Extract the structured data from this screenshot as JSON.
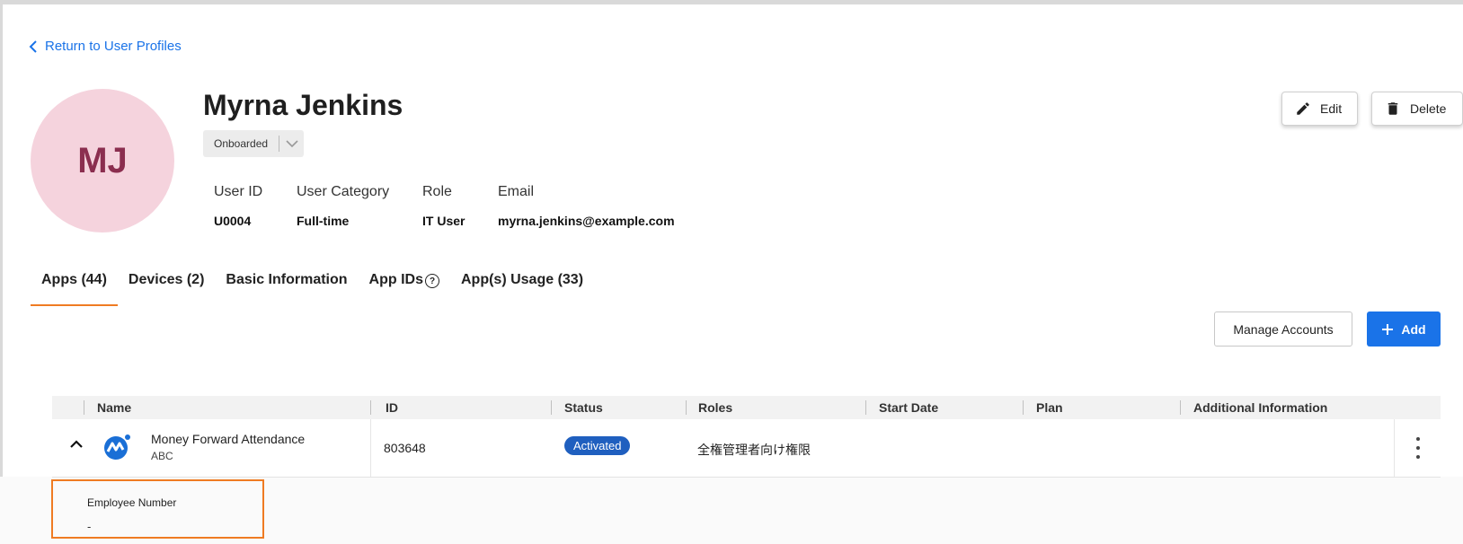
{
  "nav": {
    "back_label": "Return to User Profiles"
  },
  "profile": {
    "initials": "MJ",
    "name": "Myrna Jenkins",
    "status": "Onboarded",
    "fields": [
      {
        "label": "User ID",
        "value": "U0004"
      },
      {
        "label": "User Category",
        "value": "Full-time"
      },
      {
        "label": "Role",
        "value": "IT User"
      },
      {
        "label": "Email",
        "value": "myrna.jenkins@example.com"
      }
    ]
  },
  "actions": {
    "edit_label": "Edit",
    "delete_label": "Delete"
  },
  "tabs": [
    {
      "label": "Apps (44)",
      "active": true
    },
    {
      "label": "Devices (2)",
      "active": false
    },
    {
      "label": "Basic Information",
      "active": false
    },
    {
      "label": "App IDs",
      "active": false
    },
    {
      "label": "App(s) Usage (33)",
      "active": false
    }
  ],
  "toolbar": {
    "manage_label": "Manage Accounts",
    "add_label": "Add"
  },
  "table": {
    "columns": [
      "Name",
      "ID",
      "Status",
      "Roles",
      "Start Date",
      "Plan",
      "Additional Information"
    ],
    "rows": [
      {
        "app_name": "Money Forward Attendance",
        "app_sub": "ABC",
        "id": "803648",
        "status": "Activated",
        "roles": "全権管理者向け権限",
        "start_date": "",
        "plan": "",
        "additional": ""
      }
    ]
  },
  "detail": {
    "label": "Employee Number",
    "value": "-"
  },
  "colors": {
    "accent": "#1a73e8",
    "tab_underline": "#ef7b22",
    "avatar_bg": "#f5d3dd",
    "avatar_text": "#8b2e4f",
    "badge": "#1f5fbf"
  }
}
